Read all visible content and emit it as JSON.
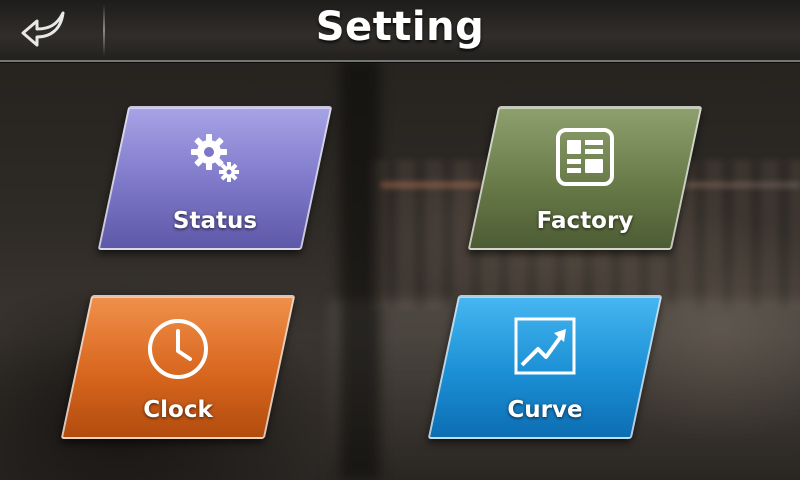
{
  "header": {
    "title": "Setting",
    "back_icon": "back-arrow-icon"
  },
  "tiles": [
    {
      "label": "Status",
      "icon": "gears-icon",
      "color": "#7d77c8"
    },
    {
      "label": "Factory",
      "icon": "form-icon",
      "color": "#687a48"
    },
    {
      "label": "Clock",
      "icon": "clock-icon",
      "color": "#d8661e"
    },
    {
      "label": "Curve",
      "icon": "chart-icon",
      "color": "#1b8fd5"
    }
  ]
}
